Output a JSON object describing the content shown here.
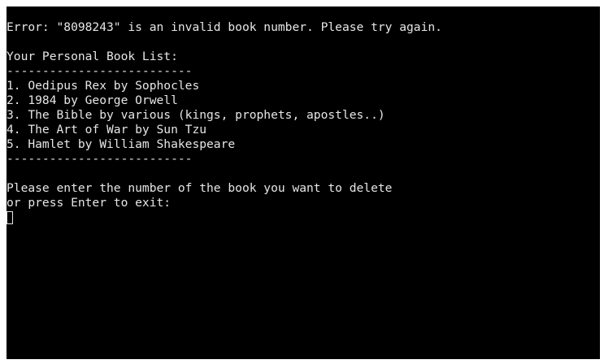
{
  "terminal": {
    "error_message": "Error: \"8098243\" is an invalid book number. Please try again.",
    "list_heading": "Your Personal Book List:",
    "separator": "--------------------------",
    "books": [
      "1. Oedipus Rex by Sophocles",
      "2. 1984 by George Orwell",
      "3. The Bible by various (kings, prophets, apostles..)",
      "4. The Art of War by Sun Tzu",
      "5. Hamlet by William Shakespeare"
    ],
    "prompt_line1": "Please enter the number of the book you want to delete",
    "prompt_line2": "or press Enter to exit:",
    "input_value": ""
  },
  "colors": {
    "background": "#000000",
    "text": "#e6e6e6"
  }
}
